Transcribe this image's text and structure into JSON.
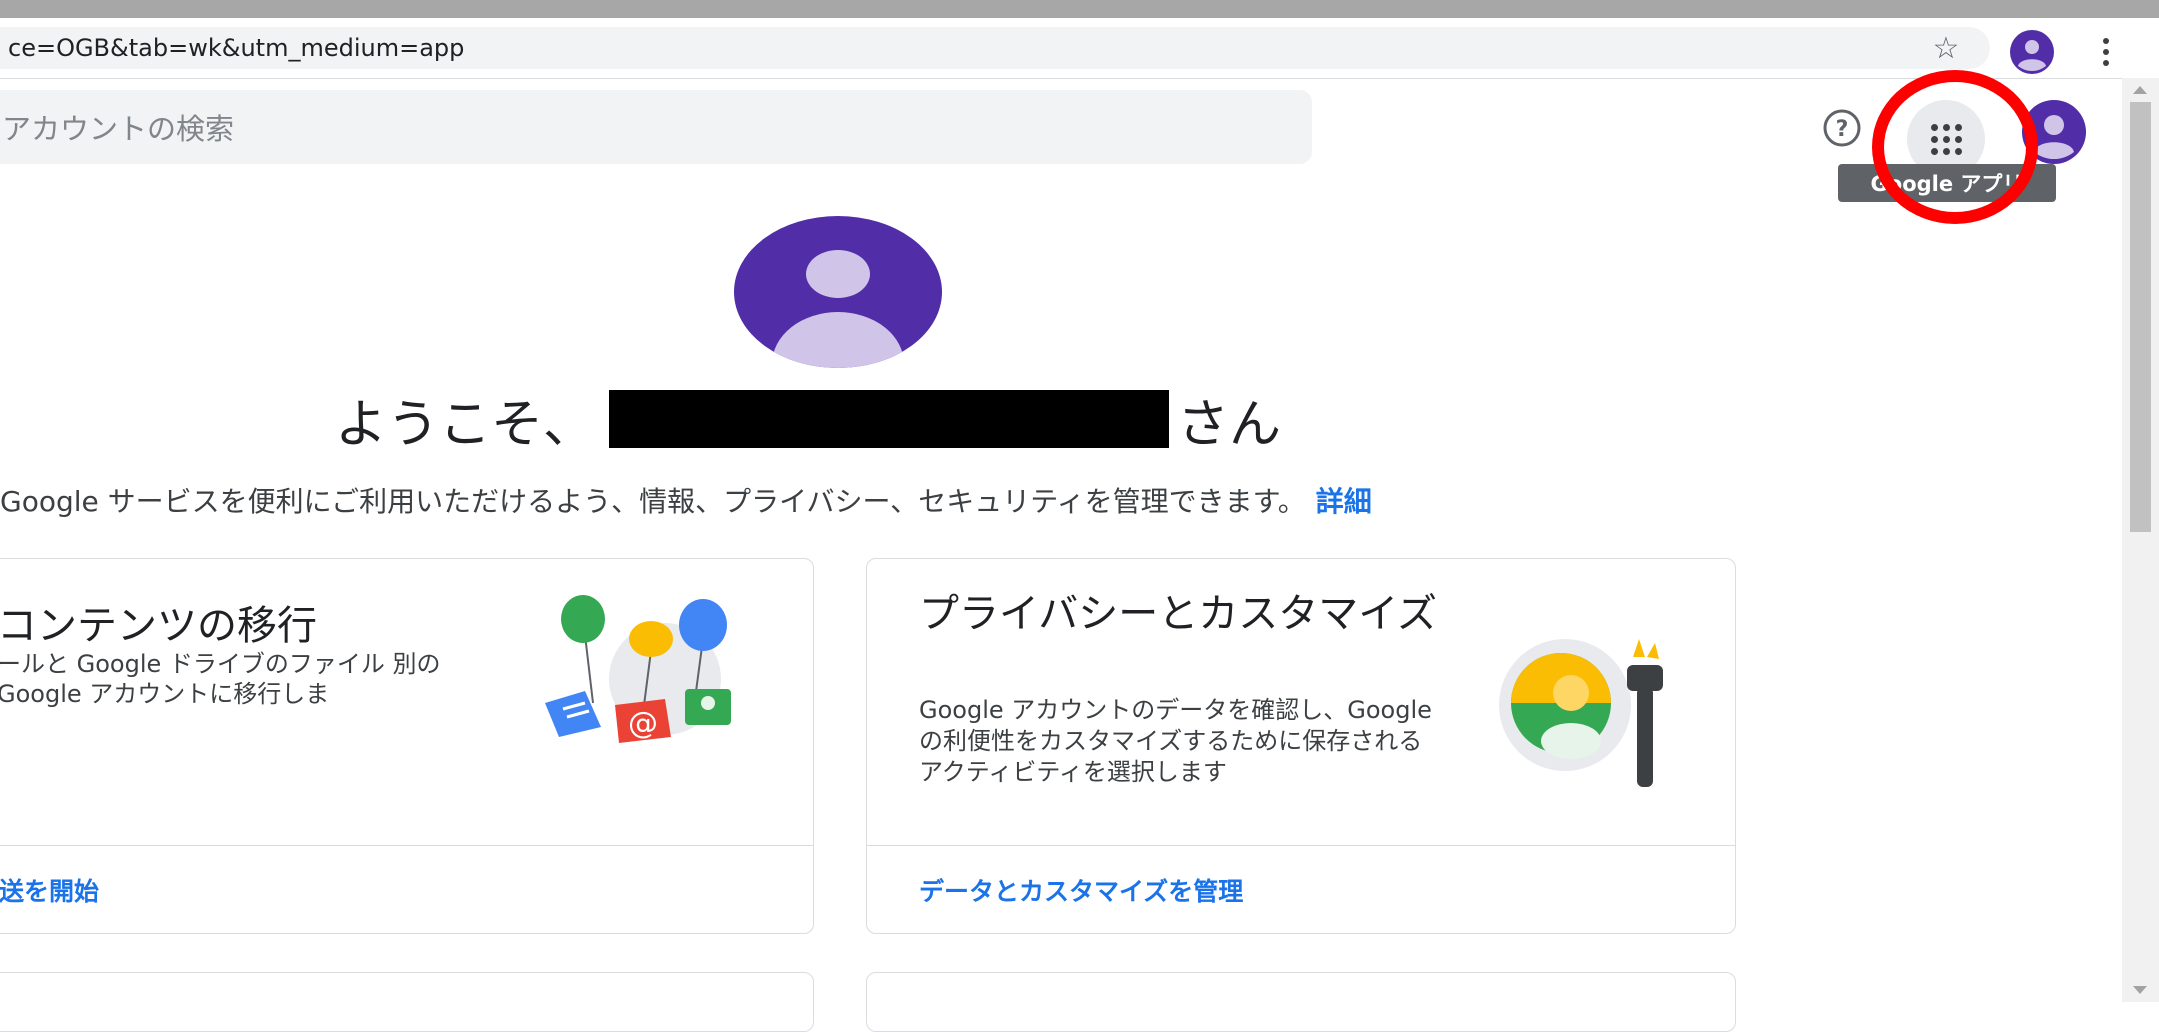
{
  "browser": {
    "url_fragment": "ce=OGB&tab=wk&utm_medium=app",
    "star_icon": "star-icon",
    "menu_icon": "kebab-menu-icon"
  },
  "header": {
    "search_placeholder": "アカウントの検索",
    "help_icon": "help-icon",
    "apps_icon": "apps-grid-icon",
    "tooltip": "Google アプリ"
  },
  "welcome": {
    "prefix": "ようこそ、",
    "suffix": "さん",
    "intro": "Google サービスを便利にご利用いただけるよう、情報、プライバシー、セキュリティを管理できます。",
    "intro_link": "詳細"
  },
  "cards": [
    {
      "title": "コンテンツの移行",
      "description": "ールと Google ドライブのファイル 別の Google アカウントに移行しま",
      "link": "送を開始"
    },
    {
      "title": "プライバシーとカスタマイズ",
      "description": "Google アカウントのデータを確認し、Google の利便性をカスタマイズするために保存されるアクティビティを選択します",
      "link": "データとカスタマイズを管理"
    }
  ],
  "colors": {
    "accent": "#1a73e8",
    "avatar": "#512da8",
    "annotation": "#ff0000"
  }
}
